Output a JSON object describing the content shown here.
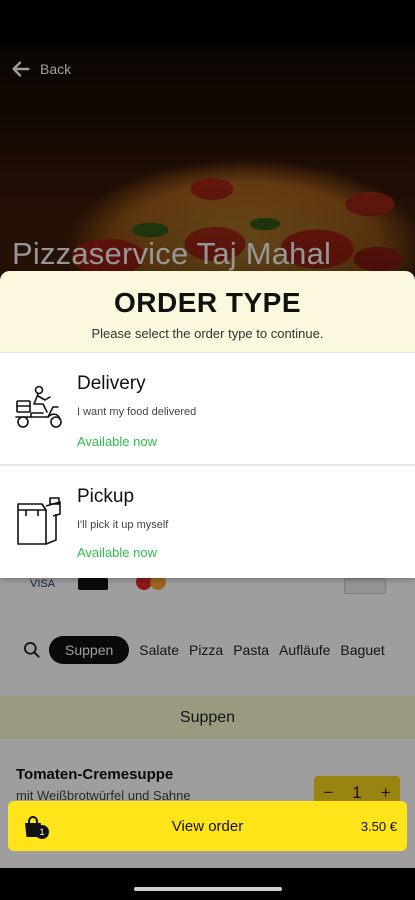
{
  "header": {
    "back_label": "Back"
  },
  "restaurant": {
    "name": "Pizzaservice Taj Mahal"
  },
  "modal": {
    "title": "ORDER TYPE",
    "subtitle": "Please select the order type to continue.",
    "options": [
      {
        "title": "Delivery",
        "description": "I want my food delivered",
        "status": "Available now",
        "icon": "delivery-scooter-icon"
      },
      {
        "title": "Pickup",
        "description": "I'll pick it up myself",
        "status": "Available now",
        "icon": "pickup-bag-icon"
      }
    ]
  },
  "categories": {
    "active": "Suppen",
    "items": [
      "Salate",
      "Pizza",
      "Pasta",
      "Aufläufe",
      "Baguet"
    ]
  },
  "menu": {
    "section_title": "Suppen",
    "item": {
      "name": "Tomaten-Cremesuppe",
      "description": "mit Weißbrotwürfel und Sahne",
      "quantity": "1"
    }
  },
  "order_bar": {
    "label": "View order",
    "price": "3.50 €",
    "count": "1"
  },
  "colors": {
    "accent_yellow": "#ffe41a",
    "available_green": "#2fbd4c",
    "header_cream": "#fbf8dd"
  }
}
